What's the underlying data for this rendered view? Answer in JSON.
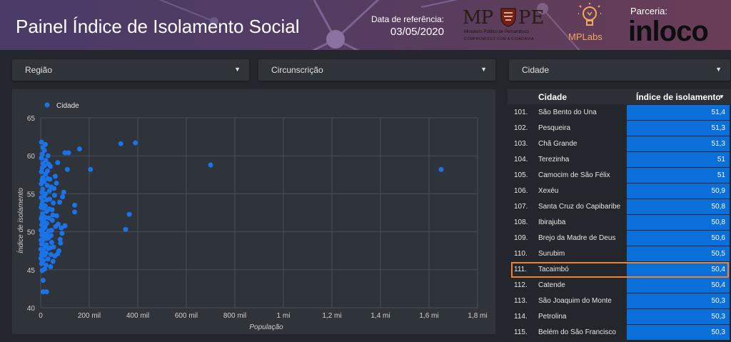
{
  "header": {
    "title": "Painel Índice de Isolamento Social",
    "ref_label": "Data de referência:",
    "ref_date": "03/05/2020",
    "mppe_left": "MP",
    "mppe_right": "PE",
    "mppe_sub1": "Ministério Público de Pernambuco",
    "mppe_sub2": "COMPROMISSO COM A CIDADANIA",
    "mplabs": "MPLabs",
    "parceria_label": "Parceria:",
    "partner": "inloco"
  },
  "filters": [
    {
      "label": "Região"
    },
    {
      "label": "Circunscrição"
    },
    {
      "label": "Cidade"
    }
  ],
  "colors": {
    "point": "#1a73e8",
    "bar": "#0b6fd9",
    "highlight": "#f0822c"
  },
  "chart_data": {
    "type": "scatter",
    "legend": [
      "Cidade"
    ],
    "legend_position": "top-left",
    "xlabel": "População",
    "ylabel": "Índice de isolamento",
    "xlim": [
      0,
      1800000
    ],
    "ylim": [
      40,
      65
    ],
    "x_ticks": [
      "0",
      "200 mil",
      "400 mil",
      "600 mil",
      "800 mil",
      "1 mi",
      "1,2 mi",
      "1,4 mi",
      "1,6 mi",
      "1,8 mi"
    ],
    "y_ticks": [
      "40",
      "45",
      "50",
      "55",
      "60",
      "65"
    ],
    "grid": true,
    "points": [
      [
        1650000,
        58.2
      ],
      [
        700000,
        58.8
      ],
      [
        390000,
        61.7
      ],
      [
        330000,
        61.6
      ],
      [
        365000,
        52.3
      ],
      [
        350000,
        50.3
      ],
      [
        205000,
        58.2
      ],
      [
        160000,
        60.9
      ],
      [
        140000,
        53.5
      ],
      [
        140000,
        52.6
      ],
      [
        110000,
        58.2
      ],
      [
        100000,
        60.4
      ],
      [
        115000,
        60.4
      ],
      [
        95000,
        55.2
      ],
      [
        90000,
        54.6
      ],
      [
        100000,
        50.8
      ],
      [
        85000,
        50.5
      ],
      [
        80000,
        49.0
      ],
      [
        75000,
        47.5
      ],
      [
        70000,
        47.1
      ],
      [
        70000,
        59.1
      ],
      [
        65000,
        56.4
      ],
      [
        60000,
        57.3
      ],
      [
        55000,
        55.7
      ],
      [
        52000,
        53.8
      ],
      [
        50000,
        52.2
      ],
      [
        48000,
        51.5
      ],
      [
        45000,
        50.2
      ],
      [
        45000,
        48.6
      ],
      [
        42000,
        47.0
      ],
      [
        40000,
        58.6
      ],
      [
        38000,
        56.9
      ],
      [
        36000,
        55.4
      ],
      [
        35000,
        53.0
      ],
      [
        34000,
        51.8
      ],
      [
        33000,
        50.1
      ],
      [
        32000,
        49.2
      ],
      [
        31000,
        47.8
      ],
      [
        30000,
        46.4
      ],
      [
        30000,
        60.0
      ],
      [
        28000,
        58.0
      ],
      [
        27000,
        56.1
      ],
      [
        26000,
        54.2
      ],
      [
        25000,
        52.7
      ],
      [
        25000,
        51.1
      ],
      [
        24000,
        49.7
      ],
      [
        23000,
        48.3
      ],
      [
        22000,
        47.2
      ],
      [
        22000,
        45.6
      ],
      [
        21000,
        59.4
      ],
      [
        20000,
        57.6
      ],
      [
        20000,
        55.0
      ],
      [
        19000,
        53.4
      ],
      [
        18000,
        51.9
      ],
      [
        18000,
        50.6
      ],
      [
        17000,
        49.4
      ],
      [
        17000,
        48.1
      ],
      [
        16000,
        46.9
      ],
      [
        16000,
        45.1
      ],
      [
        15000,
        60.7
      ],
      [
        15000,
        58.7
      ],
      [
        14000,
        56.6
      ],
      [
        14000,
        54.7
      ],
      [
        13000,
        53.1
      ],
      [
        13000,
        51.6
      ],
      [
        12000,
        50.4
      ],
      [
        12000,
        49.0
      ],
      [
        11000,
        47.6
      ],
      [
        11000,
        46.2
      ],
      [
        10000,
        43.6
      ],
      [
        10000,
        42.1
      ],
      [
        9000,
        61.1
      ],
      [
        9000,
        59.0
      ],
      [
        8500,
        57.1
      ],
      [
        8500,
        55.6
      ],
      [
        8000,
        54.0
      ],
      [
        8000,
        52.4
      ],
      [
        7500,
        51.3
      ],
      [
        7500,
        49.9
      ],
      [
        7000,
        48.8
      ],
      [
        7000,
        47.4
      ],
      [
        6500,
        46.0
      ],
      [
        6500,
        44.9
      ],
      [
        6000,
        60.2
      ],
      [
        6000,
        58.4
      ],
      [
        5500,
        56.8
      ],
      [
        5500,
        55.2
      ],
      [
        5000,
        53.6
      ],
      [
        5000,
        52.0
      ],
      [
        4500,
        50.9
      ],
      [
        4500,
        49.6
      ],
      [
        4000,
        48.4
      ],
      [
        4000,
        47.0
      ],
      [
        3500,
        45.8
      ],
      [
        3500,
        61.8
      ],
      [
        3000,
        59.7
      ],
      [
        3000,
        57.9
      ],
      [
        2500,
        56.3
      ],
      [
        2500,
        54.5
      ],
      [
        2000,
        53.2
      ],
      [
        2000,
        51.7
      ],
      [
        1500,
        50.2
      ],
      [
        1500,
        48.9
      ],
      [
        1000,
        47.7
      ],
      [
        1000,
        46.5
      ],
      [
        24000,
        42.1
      ],
      [
        29000,
        57.0
      ],
      [
        37000,
        54.3
      ],
      [
        43000,
        49.5
      ],
      [
        47000,
        52.9
      ],
      [
        53000,
        48.0
      ],
      [
        58000,
        46.8
      ],
      [
        62000,
        50.7
      ],
      [
        66000,
        52.1
      ],
      [
        72000,
        51.0
      ],
      [
        78000,
        53.9
      ],
      [
        82000,
        48.5
      ],
      [
        88000,
        49.8
      ],
      [
        41000,
        45.4
      ],
      [
        19000,
        61.5
      ],
      [
        27000,
        49.1
      ],
      [
        33000,
        58.9
      ],
      [
        39000,
        47.9
      ],
      [
        44000,
        55.9
      ],
      [
        51000,
        46.1
      ],
      [
        57000,
        54.8
      ]
    ]
  },
  "table": {
    "col_city": "Cidade",
    "col_value": "Índice de isolamento",
    "rows": [
      {
        "n": "101.",
        "city": "São Bento do Una",
        "value": "51,4"
      },
      {
        "n": "102.",
        "city": "Pesqueira",
        "value": "51,3"
      },
      {
        "n": "103.",
        "city": "Chã Grande",
        "value": "51,3"
      },
      {
        "n": "104.",
        "city": "Terezinha",
        "value": "51"
      },
      {
        "n": "105.",
        "city": "Camocim de São Félix",
        "value": "51"
      },
      {
        "n": "106.",
        "city": "Xexéu",
        "value": "50,9"
      },
      {
        "n": "107.",
        "city": "Santa Cruz do Capibaribe",
        "value": "50,8"
      },
      {
        "n": "108.",
        "city": "Ibirajuba",
        "value": "50,8"
      },
      {
        "n": "109.",
        "city": "Brejo da Madre de Deus",
        "value": "50,6"
      },
      {
        "n": "110.",
        "city": "Surubim",
        "value": "50,5"
      },
      {
        "n": "111.",
        "city": "Tacaimbó",
        "value": "50,4"
      },
      {
        "n": "112.",
        "city": "Catende",
        "value": "50,4"
      },
      {
        "n": "113.",
        "city": "São Joaquim do Monte",
        "value": "50,3"
      },
      {
        "n": "114.",
        "city": "Petrolina",
        "value": "50,3"
      },
      {
        "n": "115.",
        "city": "Belém do São Francisco",
        "value": "50,3"
      }
    ]
  }
}
